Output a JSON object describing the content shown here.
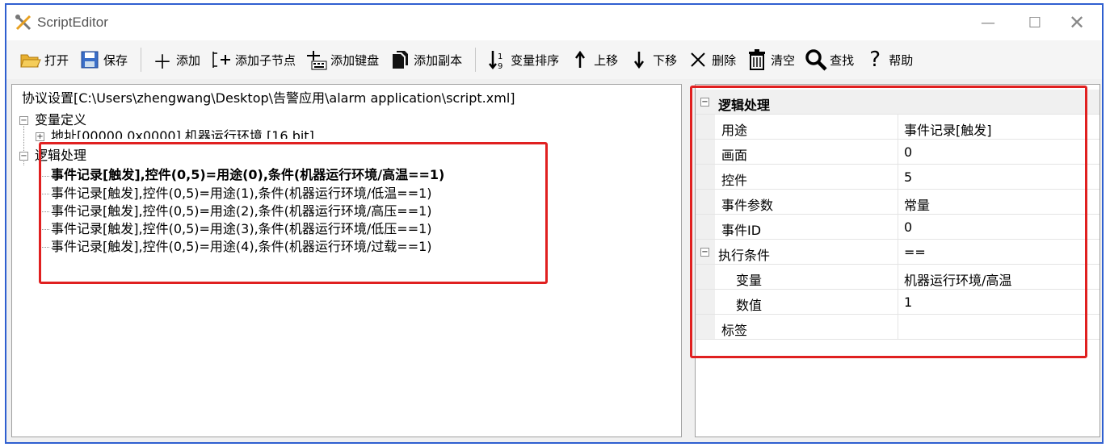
{
  "window": {
    "title": "ScriptEditor",
    "minimize": "—",
    "maximize": "☐",
    "close": "✕"
  },
  "toolbar": {
    "open": "打开",
    "save": "保存",
    "add": "添加",
    "add_child": "添加子节点",
    "add_keyboard": "添加键盘",
    "add_copy": "添加副本",
    "sort_vars": "变量排序",
    "move_up": "上移",
    "move_down": "下移",
    "delete": "删除",
    "clear": "清空",
    "find": "查找",
    "help": "帮助"
  },
  "tree": {
    "root": "协议设置[C:\\Users\\zhengwang\\Desktop\\告警应用\\alarm application\\script.xml]",
    "var_def": "变量定义",
    "address": "地址[00000,0x0000],机器运行环境,[16 bit]",
    "logic": "逻辑处理",
    "events": [
      "事件记录[触发],控件(0,5)=用途(0),条件(机器运行环境/高温==1)",
      "事件记录[触发],控件(0,5)=用途(1),条件(机器运行环境/低温==1)",
      "事件记录[触发],控件(0,5)=用途(2),条件(机器运行环境/高压==1)",
      "事件记录[触发],控件(0,5)=用途(3),条件(机器运行环境/低压==1)",
      "事件记录[触发],控件(0,5)=用途(4),条件(机器运行环境/过载==1)"
    ]
  },
  "properties": {
    "category": "逻辑处理",
    "rows": [
      {
        "name": "用途",
        "value": "事件记录[触发]"
      },
      {
        "name": "画面",
        "value": "0"
      },
      {
        "name": "控件",
        "value": "5"
      },
      {
        "name": "事件参数",
        "value": "常量"
      },
      {
        "name": "事件ID",
        "value": "0"
      }
    ],
    "condition": {
      "name": "执行条件",
      "value": "=="
    },
    "condition_rows": [
      {
        "name": "变量",
        "value": "机器运行环境/高温"
      },
      {
        "name": "数值",
        "value": "1"
      }
    ],
    "tag": {
      "name": "标签",
      "value": ""
    }
  }
}
